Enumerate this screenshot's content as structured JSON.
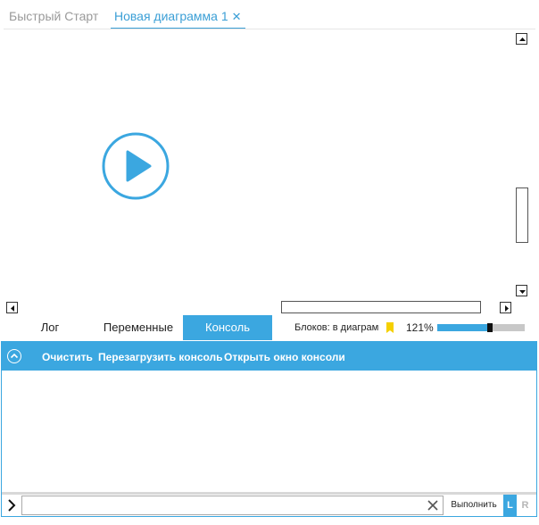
{
  "tabs": {
    "quick_start": "Быстрый Старт",
    "diagram": "Новая диаграмма 1",
    "close_glyph": "✕"
  },
  "bottom_tabs": {
    "log": "Лог",
    "variables": "Переменные",
    "console": "Консоль",
    "active": "console"
  },
  "status": {
    "blocks_label": "Блоков: в диаграмме",
    "zoom": "121%",
    "zoom_level_fraction": 0.6
  },
  "console": {
    "actions": {
      "clear": "Очистить",
      "reload": "Перезагрузить консоль",
      "open_window": "Открыть окно консоли"
    },
    "input_value": "",
    "run_label": "Выполнить",
    "l_label": "L",
    "r_label": "R",
    "active_side": "L"
  },
  "colors": {
    "accent": "#3ba7e0",
    "tab_text_inactive": "#9a9a9a",
    "bookmark": "#f5d000"
  },
  "icons": {
    "play": "play-circle-icon",
    "collapse": "chevron-up-circle-icon",
    "prompt": "chevron-right-icon",
    "clear": "close-icon",
    "bookmark": "bookmark-icon"
  }
}
